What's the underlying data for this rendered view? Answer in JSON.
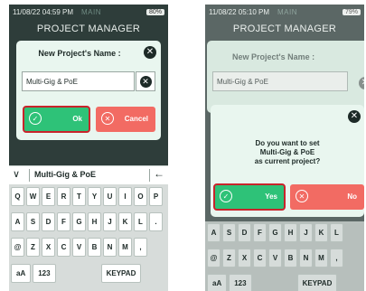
{
  "screen1": {
    "status": {
      "time": "11/08/22 04:59 PM",
      "center": "MAIN",
      "battery": "80%"
    },
    "header_title": "PROJECT MANAGER",
    "dialog": {
      "title": "New Project's Name :",
      "input_value": "Multi-Gig & PoE",
      "ok_label": "Ok",
      "cancel_label": "Cancel"
    },
    "keyboard": {
      "input_value": "Multi-Gig & PoE",
      "rows": [
        [
          "Q",
          "W",
          "E",
          "R",
          "T",
          "Y",
          "U",
          "I",
          "O",
          "P"
        ],
        [
          "A",
          "S",
          "D",
          "F",
          "G",
          "H",
          "J",
          "K",
          "L",
          "."
        ],
        [
          "@",
          "Z",
          "X",
          "C",
          "V",
          "B",
          "N",
          "M",
          ","
        ]
      ],
      "bottom": {
        "left": "aA",
        "mid": "123",
        "right": "KEYPAD"
      }
    }
  },
  "screen2": {
    "status": {
      "time": "11/08/22 05:10 PM",
      "center": "MAIN",
      "battery": "79%"
    },
    "header_title": "PROJECT MANAGER",
    "dialog_bg": {
      "title": "New Project's Name :",
      "input_value": "Multi-Gig & PoE"
    },
    "confirm": {
      "line1": "Do you want to set",
      "line2": "Multi-Gig & PoE",
      "line3": "as current project?",
      "yes_label": "Yes",
      "no_label": "No"
    },
    "keyboard": {
      "rows": [
        [
          "A",
          "S",
          "D",
          "F",
          "G",
          "H",
          "J",
          "K",
          "L"
        ],
        [
          "@",
          "Z",
          "X",
          "C",
          "V",
          "B",
          "N",
          "M",
          ","
        ]
      ],
      "bottom": {
        "left": "aA",
        "mid": "123",
        "right": "KEYPAD"
      }
    }
  },
  "colors": {
    "ok": "#2ec278",
    "cancel": "#f26b63",
    "highlight": "#c8242b",
    "dialog": "#e9f6ef",
    "dark": "#2e3d3a"
  }
}
